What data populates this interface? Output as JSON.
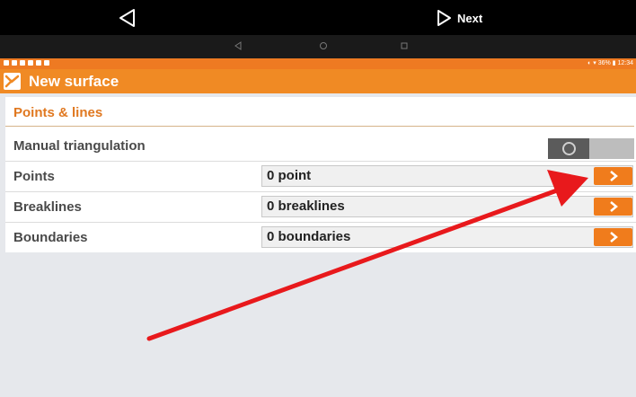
{
  "topnav": {
    "next_label": "Next"
  },
  "statusbar": {
    "right_text": "◐ ▾ 36% ▮ 12:34"
  },
  "appbar": {
    "title": "New surface"
  },
  "panel": {
    "section_title": "Points & lines",
    "manual_triangulation": {
      "label": "Manual triangulation",
      "on": false
    },
    "rows": [
      {
        "label": "Points",
        "value": "0 point"
      },
      {
        "label": "Breaklines",
        "value": "0 breaklines"
      },
      {
        "label": "Boundaries",
        "value": "0 boundaries"
      }
    ]
  },
  "colors": {
    "accent": "#f08a24",
    "arrow": "#e8191c"
  }
}
